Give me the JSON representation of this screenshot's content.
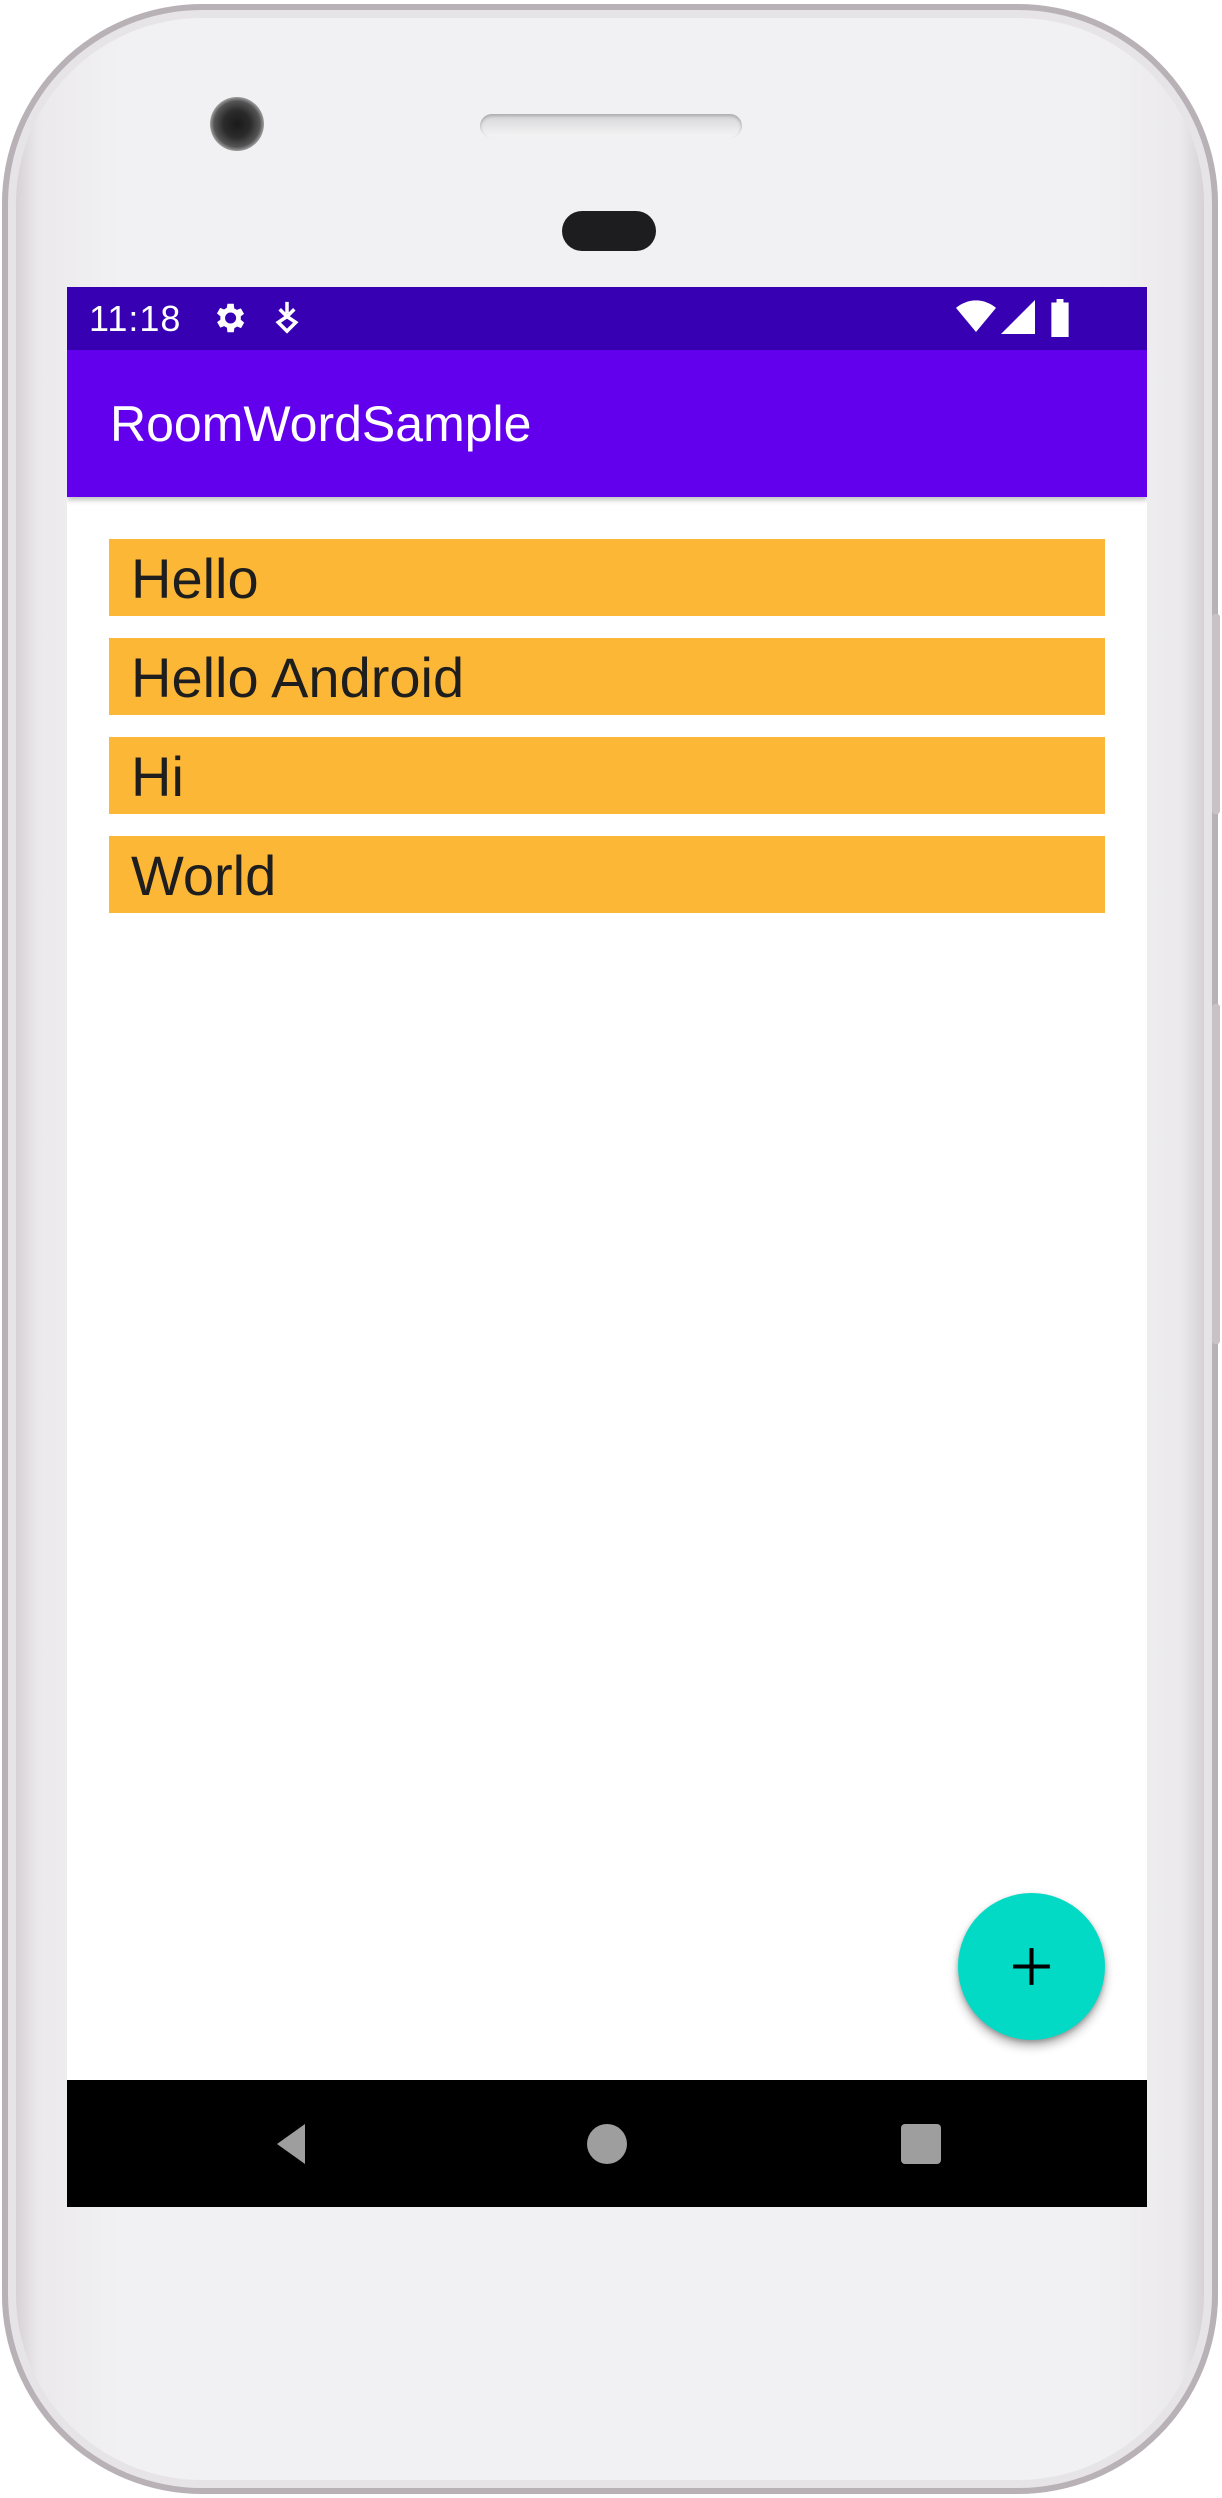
{
  "status_bar": {
    "time": "11:18",
    "left_icons": [
      "gear-icon",
      "download-icon"
    ],
    "right_icons": [
      "wifi-icon",
      "signal-icon",
      "battery-icon"
    ]
  },
  "app_bar": {
    "title": "RoomWordSample"
  },
  "word_list": {
    "items": [
      {
        "word": "Hello"
      },
      {
        "word": "Hello Android"
      },
      {
        "word": "Hi"
      },
      {
        "word": "World"
      }
    ],
    "item_color": "#fdb736"
  },
  "fab": {
    "icon": "plus-icon",
    "color": "#03dac5"
  },
  "nav_bar": {
    "buttons": [
      "back-icon",
      "home-icon",
      "recents-icon"
    ]
  },
  "colors": {
    "status_bar": "#3700b3",
    "primary": "#6200ee",
    "accent": "#03dac5"
  }
}
